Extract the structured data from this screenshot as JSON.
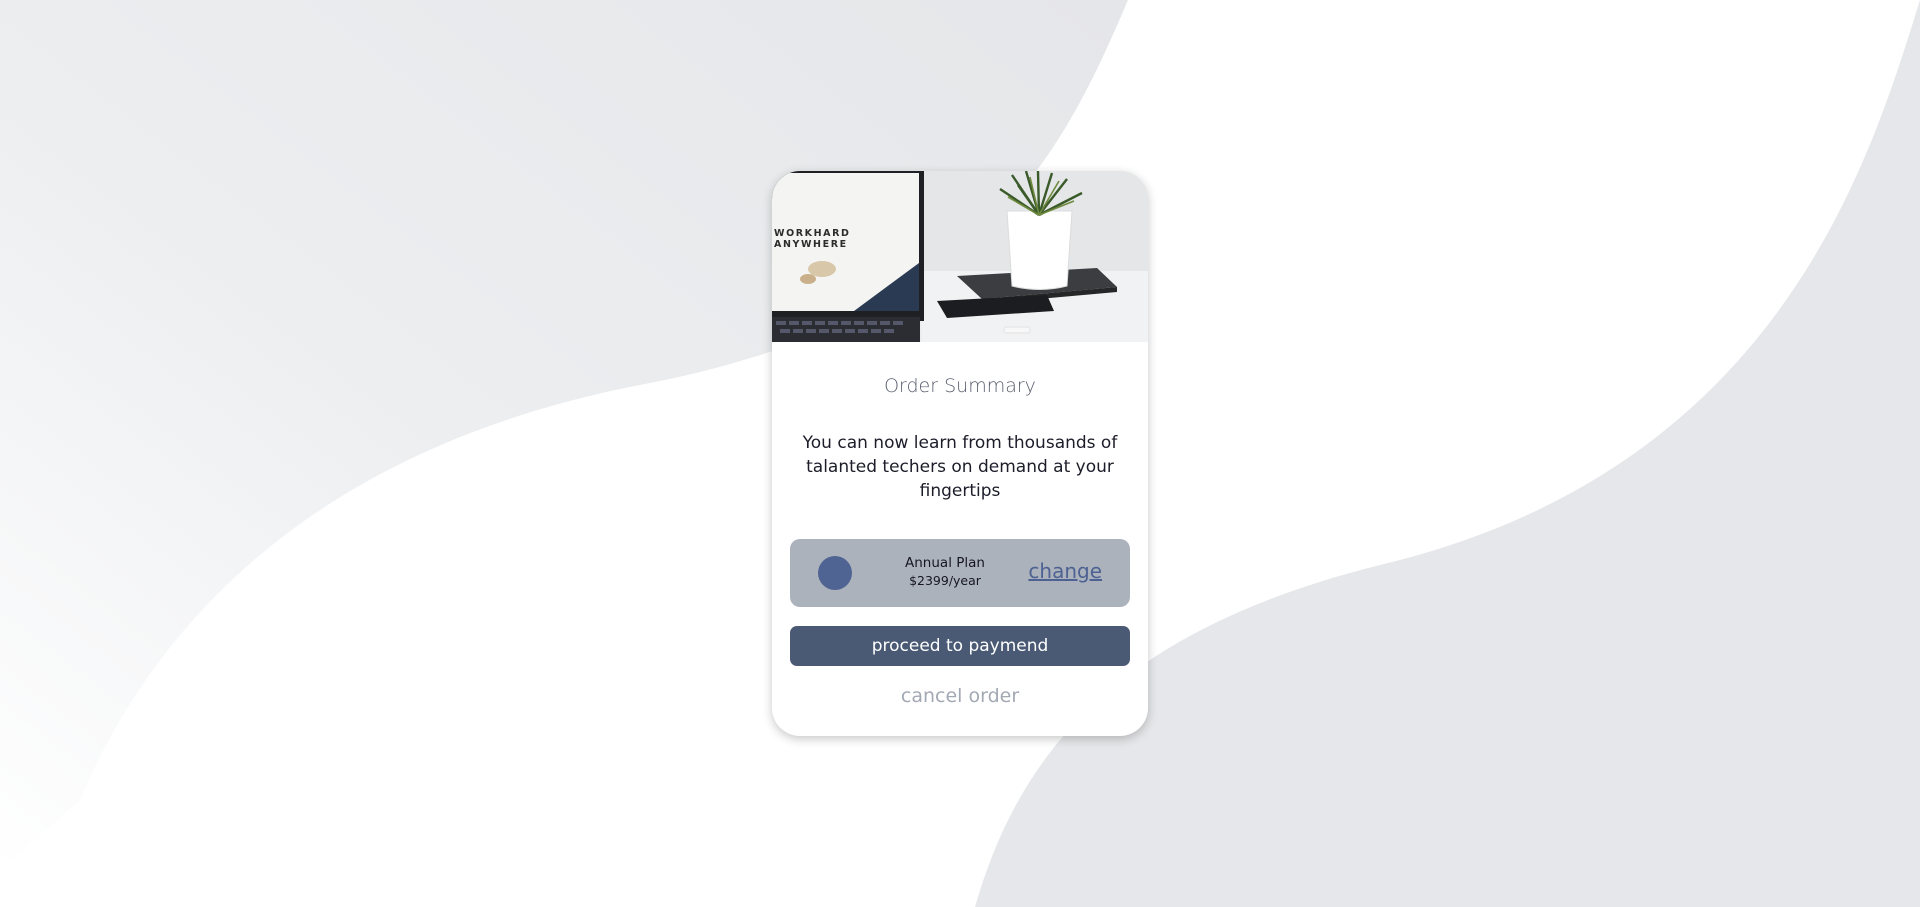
{
  "order_summary": {
    "hero_image": {
      "laptop_screen_text_line1": "WORKHARD",
      "laptop_screen_text_line2": "ANYWHERE"
    },
    "title": "Order Summary",
    "description": "You can now learn from thousands of talanted techers on demand at your fingertips",
    "plan": {
      "icon": "plan-circle-icon",
      "name": "Annual Plan",
      "price": "$2399/year",
      "change_label": "change"
    },
    "proceed_label": "proceed to paymend",
    "cancel_label": "cancel order"
  },
  "colors": {
    "background_wave": "#e6e7ea",
    "card": "#ffffff",
    "plan_box": "#acb2bc",
    "plan_icon": "#4f6493",
    "link": "#4d6292",
    "primary_button": "#4a5a75",
    "cancel_text": "#a3a9b3"
  }
}
